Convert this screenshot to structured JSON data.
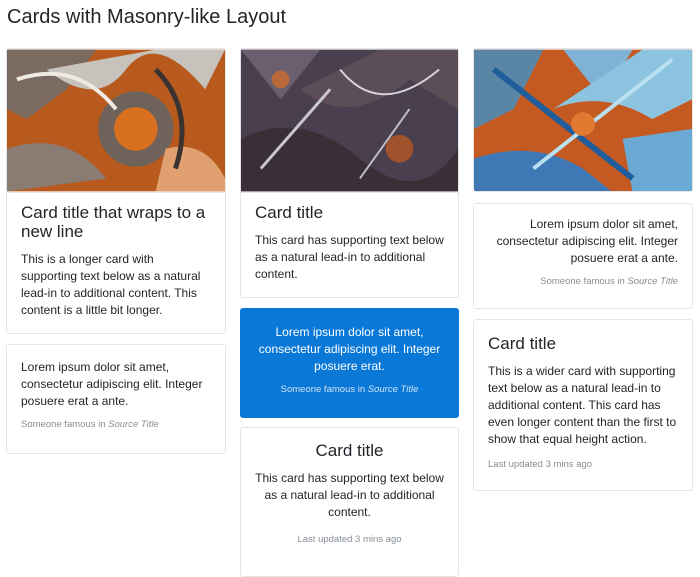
{
  "page": {
    "title": "Cards with Masonry-like Layout"
  },
  "col1": {
    "card1": {
      "image_alt": "orange and grey abstract painting",
      "title": "Card title that wraps to a new line",
      "text": "This is a longer card with supporting text below as a natural lead-in to additional content. This content is a little bit longer."
    },
    "quote1": {
      "text": "Lorem ipsum dolor sit amet, consectetur adipiscing elit. Integer posuere erat a ante.",
      "footer_prefix": "Someone famous in ",
      "footer_source": "Source Title"
    }
  },
  "col2": {
    "card2": {
      "image_alt": "dark purple abstract painting",
      "title": "Card title",
      "text": "This card has supporting text below as a natural lead-in to additional content."
    },
    "quote2": {
      "text": "Lorem ipsum dolor sit amet, consectetur adipiscing elit. Integer posuere erat.",
      "footer_prefix": "Someone famous in ",
      "footer_source": "Source Title"
    },
    "card3": {
      "title": "Card title",
      "text": "This card has supporting text below as a natural lead-in to additional content.",
      "updated": "Last updated 3 mins ago"
    }
  },
  "col3": {
    "card4": {
      "image_alt": "blue and orange abstract painting"
    },
    "quote3": {
      "text": "Lorem ipsum dolor sit amet, consectetur adipiscing elit. Integer posuere erat a ante.",
      "footer_prefix": "Someone famous in ",
      "footer_source": "Source Title"
    },
    "card5": {
      "title": "Card title",
      "text": "This is a wider card with supporting text below as a natural lead-in to additional content. This card has even longer content than the first to show that equal height action.",
      "updated": "Last updated 3 mins ago"
    }
  },
  "colors": {
    "primary": "#0a78d7",
    "border": "#e5e5e5",
    "muted": "#868e96"
  }
}
